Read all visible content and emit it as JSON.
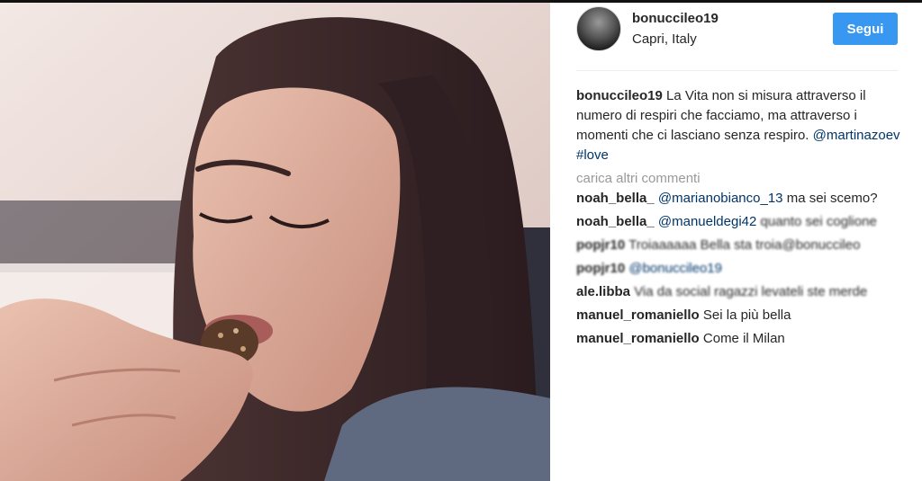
{
  "post": {
    "username": "bonuccileo19",
    "location": "Capri, Italy",
    "follow_label": "Segui"
  },
  "caption": {
    "user": "bonuccileo19",
    "text": "La Vita non si misura attraverso il numero di respiri che facciamo, ma attraverso i momenti che ci lasciano senza respiro.",
    "mention": "@martinazoev",
    "hashtag": "#love"
  },
  "load_more": "carica altri commenti",
  "comments": [
    {
      "user": "noah_bella_",
      "mention": "@marianobianco_13",
      "text": "ma sei scemo?"
    },
    {
      "user": "noah_bella_",
      "mention": "@manueldegi42",
      "text": "quanto sei coglione"
    },
    {
      "user": "popjr10",
      "mention": "",
      "text": "Troiaaaaaa Bella sta troia@bonuccileo"
    },
    {
      "user": "popjr10",
      "mention": "@bonuccileo19",
      "text": ""
    },
    {
      "user": "ale.libba",
      "mention": "",
      "text": "Via da social ragazzi levateli ste merde"
    },
    {
      "user": "manuel_romaniello",
      "mention": "",
      "text": "Sei la più bella"
    },
    {
      "user": "manuel_romaniello",
      "mention": "",
      "text": "Come il Milan"
    }
  ],
  "colors": {
    "accent": "#3897f0",
    "link": "#003569",
    "text": "#262626",
    "muted": "#999999"
  }
}
